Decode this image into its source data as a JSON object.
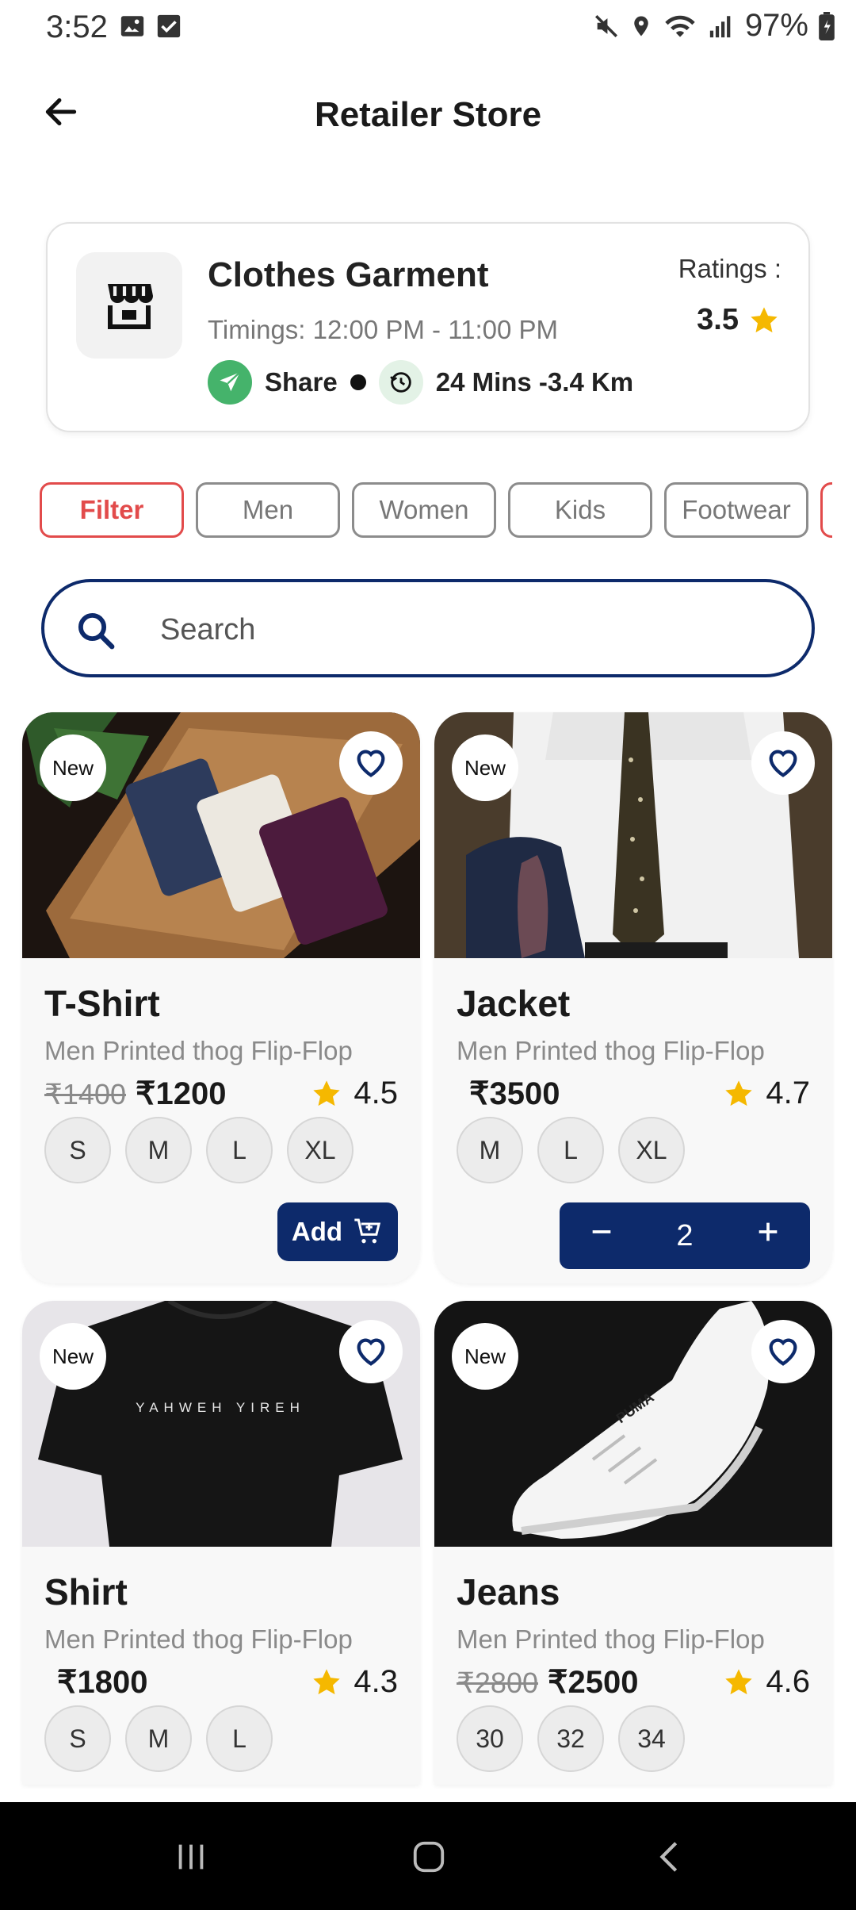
{
  "status": {
    "time": "3:52",
    "battery": "97%"
  },
  "header": {
    "title": "Retailer Store"
  },
  "store": {
    "name": "Clothes Garment",
    "timings": "Timings: 12:00 PM - 11:00 PM",
    "share_label": "Share",
    "delivery": "24 Mins -3.4 Km",
    "ratings_label": "Ratings :",
    "rating": "3.5"
  },
  "filters": [
    {
      "label": "Filter",
      "active": true
    },
    {
      "label": "Men",
      "active": false
    },
    {
      "label": "Women",
      "active": false
    },
    {
      "label": "Kids",
      "active": false
    },
    {
      "label": "Footwear",
      "active": false
    },
    {
      "label": "",
      "active": true
    }
  ],
  "search": {
    "placeholder": "Search"
  },
  "products": [
    {
      "badge": "New",
      "name": "T-Shirt",
      "description": "Men Printed thog Flip-Flop",
      "old_price": "₹1400",
      "price": "₹1200",
      "rating": "4.5",
      "sizes": [
        "S",
        "M",
        "L",
        "XL"
      ],
      "add_label": "Add"
    },
    {
      "badge": "New",
      "name": "Jacket",
      "description": "Men Printed thog Flip-Flop",
      "price": "₹3500",
      "rating": "4.7",
      "sizes": [
        "M",
        "L",
        "XL"
      ],
      "quantity": "2"
    },
    {
      "badge": "New",
      "name": "Shirt",
      "description": "Men Printed thog Flip-Flop",
      "price": "₹1800",
      "rating": "4.3",
      "sizes": [
        "S",
        "M",
        "L"
      ],
      "tshirt_print": "YAHWEH YIREH"
    },
    {
      "badge": "New",
      "name": "Jeans",
      "description": "Men Printed thog Flip-Flop",
      "old_price": "₹2800",
      "price": "₹2500",
      "rating": "4.6",
      "sizes": [
        "30",
        "32",
        "34"
      ]
    }
  ],
  "colors": {
    "primary": "#0d2a6b",
    "accent_red": "#e24b4b",
    "star": "#f5b800",
    "share_green": "#45b36b"
  }
}
